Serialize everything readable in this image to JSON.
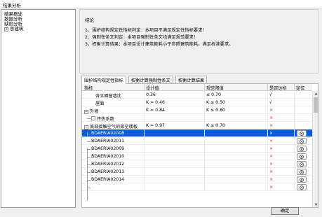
{
  "window": {
    "title": "结果分析"
  },
  "tree": {
    "items": [
      {
        "label": "结果概述"
      },
      {
        "label": "数据分析"
      },
      {
        "label": "缺陷分析"
      },
      {
        "label": "总建筑",
        "expander": "+"
      }
    ]
  },
  "summary": {
    "title": "结论",
    "lines": [
      "1、围护结构规定性指标判定：本项目不满足规定性指标要求！",
      "2、强制性条文判定：本项目强制性条文均满足规范要求！",
      "3、权衡计算结果：本项目设计建筑能耗小于参照建筑能耗，满足标准要求。"
    ]
  },
  "tabs": [
    {
      "label": "围护结构规定性指标"
    },
    {
      "label": "权衡计算强制性条文"
    },
    {
      "label": "权衡计算结果"
    }
  ],
  "grid": {
    "headers": {
      "indicator": "指标",
      "design": "设计值",
      "limit": "规范限值",
      "pass": "是否达标",
      "locate": "定位"
    },
    "rows": [
      {
        "indicator": "各立面窗墙比",
        "design": "0.36",
        "limit": "≤ 0.70",
        "pass": "√",
        "status": "ok"
      },
      {
        "indicator": "屋面",
        "design": "K = 0.46",
        "limit": "K ≤ 0.50",
        "pass": "√",
        "status": "ok"
      },
      {
        "indicator": "外墙",
        "design": "K = 0.84",
        "limit": "K ≤ 0.80",
        "pass": "×",
        "status": "bad",
        "expander": "−"
      },
      {
        "indicator": "传热系数",
        "design": "",
        "limit": "",
        "pass": "×",
        "status": "bad",
        "child": true
      },
      {
        "indicator": "底部接触空气的架空楼板",
        "design": "K = 0.97",
        "limit": "K ≤ 0.70",
        "pass": "×",
        "status": "bad",
        "expander": "−"
      },
      {
        "indicator": "BDAERIA02008",
        "design": "",
        "limit": "",
        "pass": "×",
        "status": "bad",
        "child": true,
        "selected": true,
        "locate": true
      },
      {
        "indicator": "BDAERIA02011",
        "design": "",
        "limit": "",
        "pass": "×",
        "status": "bad",
        "child": true,
        "locate": true
      },
      {
        "indicator": "BDAERIA02009",
        "design": "",
        "limit": "",
        "pass": "×",
        "status": "bad",
        "child": true,
        "locate": true
      },
      {
        "indicator": "BDAERIA02010",
        "design": "",
        "limit": "",
        "pass": "×",
        "status": "bad",
        "child": true,
        "locate": true
      },
      {
        "indicator": "BDAERIA02012",
        "design": "",
        "limit": "",
        "pass": "×",
        "status": "bad",
        "child": true,
        "locate": true
      },
      {
        "indicator": "BDAERIA02013",
        "design": "",
        "limit": "",
        "pass": "×",
        "status": "bad",
        "child": true,
        "locate": true
      },
      {
        "indicator": "BDAERIA02014",
        "design": "",
        "limit": "",
        "pass": "×",
        "status": "bad",
        "child": true,
        "locate": true
      },
      {
        "indicator": "",
        "design": "",
        "limit": "",
        "pass": "×",
        "status": "bad",
        "child": true,
        "locate": true
      }
    ]
  },
  "footer": {
    "confirm_label": "确定"
  },
  "colors": {
    "selection": "#0a5bd6",
    "fail": "#e02020"
  }
}
